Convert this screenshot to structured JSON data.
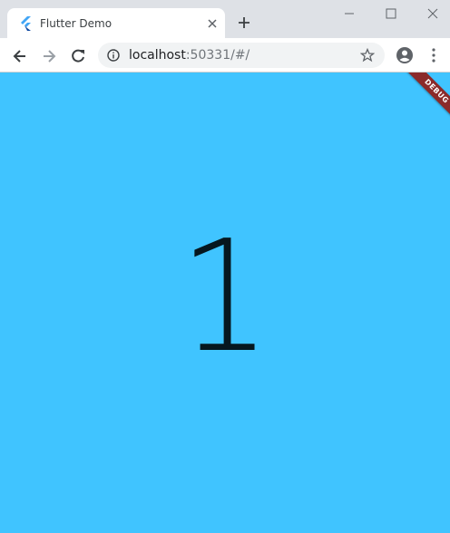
{
  "browser": {
    "tab": {
      "title": "Flutter Demo",
      "favicon": "flutter-logo-icon",
      "close": "close-icon"
    },
    "new_tab": "plus-icon",
    "window_controls": [
      "minimize-icon",
      "maximize-icon",
      "close-icon"
    ],
    "toolbar": {
      "back": "arrow-left-icon",
      "forward": "arrow-right-icon",
      "reload": "reload-icon",
      "url_host": "localhost",
      "url_rest": ":50331/#/",
      "site_info": "info-icon",
      "bookmark": "star-icon",
      "profile": "profile-icon",
      "menu": "kebab-menu-icon"
    }
  },
  "app": {
    "counter_value": "1",
    "debug_banner": "DEBUG",
    "background_color": "#40c4ff",
    "text_color": "#06171f",
    "banner_color": "#8b2a2a"
  }
}
